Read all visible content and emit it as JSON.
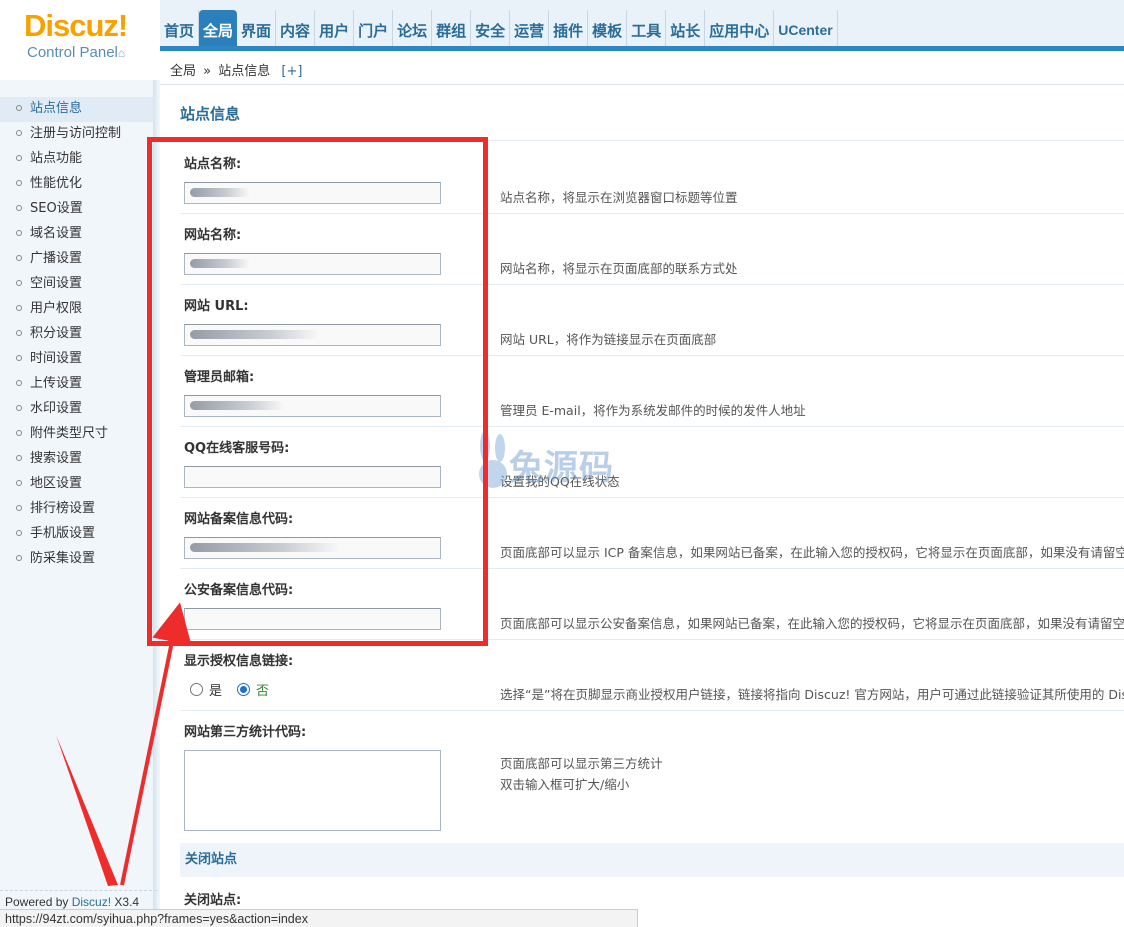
{
  "logo": {
    "brand": "Discuz!",
    "sub": "Control Panel",
    "home_icon": "home-icon"
  },
  "nav": [
    {
      "label": "首页"
    },
    {
      "label": "全局",
      "active": true
    },
    {
      "label": "界面"
    },
    {
      "label": "内容"
    },
    {
      "label": "用户"
    },
    {
      "label": "门户"
    },
    {
      "label": "论坛"
    },
    {
      "label": "群组"
    },
    {
      "label": "安全"
    },
    {
      "label": "运营"
    },
    {
      "label": "插件"
    },
    {
      "label": "模板"
    },
    {
      "label": "工具"
    },
    {
      "label": "站长"
    },
    {
      "label": "应用中心"
    },
    {
      "label": "UCenter"
    }
  ],
  "breadcrumb": {
    "root": "全局",
    "sep": "»",
    "current": "站点信息",
    "add": "[+]"
  },
  "sidebar": {
    "items": [
      {
        "label": "站点信息",
        "active": true
      },
      {
        "label": "注册与访问控制"
      },
      {
        "label": "站点功能"
      },
      {
        "label": "性能优化"
      },
      {
        "label": "SEO设置"
      },
      {
        "label": "域名设置"
      },
      {
        "label": "广播设置"
      },
      {
        "label": "空间设置"
      },
      {
        "label": "用户权限"
      },
      {
        "label": "积分设置"
      },
      {
        "label": "时间设置"
      },
      {
        "label": "上传设置"
      },
      {
        "label": "水印设置"
      },
      {
        "label": "附件类型尺寸"
      },
      {
        "label": "搜索设置"
      },
      {
        "label": "地区设置"
      },
      {
        "label": "排行榜设置"
      },
      {
        "label": "手机版设置"
      },
      {
        "label": "防采集设置"
      }
    ],
    "powered_prefix": "Powered by",
    "powered_link": "Discuz!",
    "powered_version": "X3.4"
  },
  "main": {
    "title": "站点信息",
    "fields": [
      {
        "label": "站点名称:",
        "desc": "站点名称，将显示在浏览器窗口标题等位置"
      },
      {
        "label": "网站名称:",
        "desc": "网站名称，将显示在页面底部的联系方式处"
      },
      {
        "label": "网站 URL:",
        "desc": "网站 URL，将作为链接显示在页面底部"
      },
      {
        "label": "管理员邮箱:",
        "desc": "管理员 E-mail，将作为系统发邮件的时候的发件人地址"
      },
      {
        "label": "QQ在线客服号码:",
        "desc": "设置我的QQ在线状态"
      },
      {
        "label": "网站备案信息代码:",
        "desc": "页面底部可以显示 ICP 备案信息，如果网站已备案，在此输入您的授权码，它将显示在页面底部，如果没有请留空"
      },
      {
        "label": "公安备案信息代码:",
        "desc": "页面底部可以显示公安备案信息，如果网站已备案，在此输入您的授权码，它将显示在页面底部，如果没有请留空"
      }
    ],
    "license": {
      "label": "显示授权信息链接:",
      "yes": "是",
      "no": "否",
      "selected": "否",
      "desc": "选择“是”将在页脚显示商业授权用户链接，链接将指向 Discuz! 官方网站，用户可通过此链接验证其所使用的 Discuz"
    },
    "stats": {
      "label": "网站第三方统计代码:",
      "desc1": "页面底部可以显示第三方统计",
      "desc2": "双击输入框可扩大/缩小"
    },
    "close_section": "关闭站点",
    "close_label": "关闭站点:"
  },
  "watermark": {
    "text": "兔源码"
  },
  "statusbar": {
    "url": "https://94zt.com/syihua.php?frames=yes&action=index"
  },
  "colors": {
    "accent": "#2b6c99",
    "nav_active": "#2b7fbb",
    "annotation": "#ee2c2c",
    "brand": "#f7a200"
  }
}
